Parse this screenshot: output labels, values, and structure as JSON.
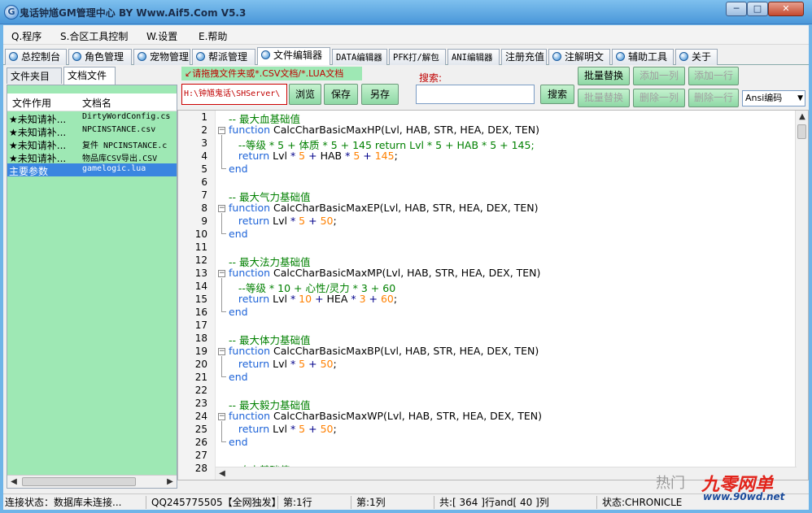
{
  "window": {
    "title": "鬼话钟馗GM管理中心 BY Www.Aif5.Com   V5.3",
    "min": "─",
    "max": "□",
    "close": "✕"
  },
  "menu": [
    "Q.程序",
    "S.合区工具控制",
    "W.设置",
    "E.帮助"
  ],
  "tabs": [
    {
      "label": "总控制台",
      "icon": "dot"
    },
    {
      "label": "角色管理",
      "icon": "dot"
    },
    {
      "label": "宠物管理",
      "icon": "dot"
    },
    {
      "label": "帮派管理",
      "icon": "dot"
    },
    {
      "label": "文件编辑器",
      "icon": "dot"
    },
    {
      "label": "DATA编辑器",
      "icon": "none"
    },
    {
      "label": "PFK打/解包",
      "icon": "none"
    },
    {
      "label": "ANI编辑器",
      "icon": "none"
    },
    {
      "label": "注册充值",
      "icon": "none"
    },
    {
      "label": "注解明文",
      "icon": "dot"
    },
    {
      "label": "辅助工具",
      "icon": "dot"
    },
    {
      "label": "关于",
      "icon": "dot"
    }
  ],
  "left": {
    "subtabs": [
      "文件夹目录",
      "文档文件"
    ],
    "headers": [
      "文件作用",
      "文档名"
    ],
    "rows": [
      {
        "role": "★未知请补...",
        "file": "DirtyWordConfig.cs"
      },
      {
        "role": "★未知请补...",
        "file": "NPCINSTANCE.csv"
      },
      {
        "role": "★未知请补...",
        "file": "复件 NPCINSTANCE.c"
      },
      {
        "role": "★未知请补...",
        "file": "物品库CSV导出.CSV"
      },
      {
        "role": "主要参数",
        "file": "gamelogic.lua"
      }
    ]
  },
  "toolbar": {
    "hint": "↙请拖拽文件夹或*.CSV文档/*.LUA文档",
    "path": "H:\\钟馗鬼话\\SHServer\\",
    "browse": "浏览",
    "save": "保存",
    "save_as": "另存",
    "search_label": "搜索:",
    "search_value": "",
    "search_btn": "搜索",
    "batch_replace_1": "批量替换",
    "batch_replace_2": "批量替换",
    "add_col": "添加一列",
    "add_row": "添加一行",
    "del_col": "删除一列",
    "del_row": "删除一行",
    "encoding": "Ansi编码"
  },
  "editor": {
    "line_numbers": [
      "1",
      "2",
      "3",
      "4",
      "5",
      "6",
      "7",
      "8",
      "9",
      "10",
      "11",
      "12",
      "13",
      "14",
      "15",
      "16",
      "17",
      "18",
      "19",
      "20",
      "21",
      "22",
      "23",
      "24",
      "25",
      "26",
      "27",
      "28"
    ]
  },
  "status": {
    "conn": "连接状态：数据库未连接...",
    "qq": "QQ245775505【全网独发】",
    "row": "第:1行",
    "col": "第:1列",
    "total": "共:[ 364 ]行and[ 40 ]列",
    "state": "状态:CHRONICLE"
  },
  "watermark": {
    "hot": "热门",
    "brand": "九零网单",
    "url": "www.90wd.net"
  }
}
